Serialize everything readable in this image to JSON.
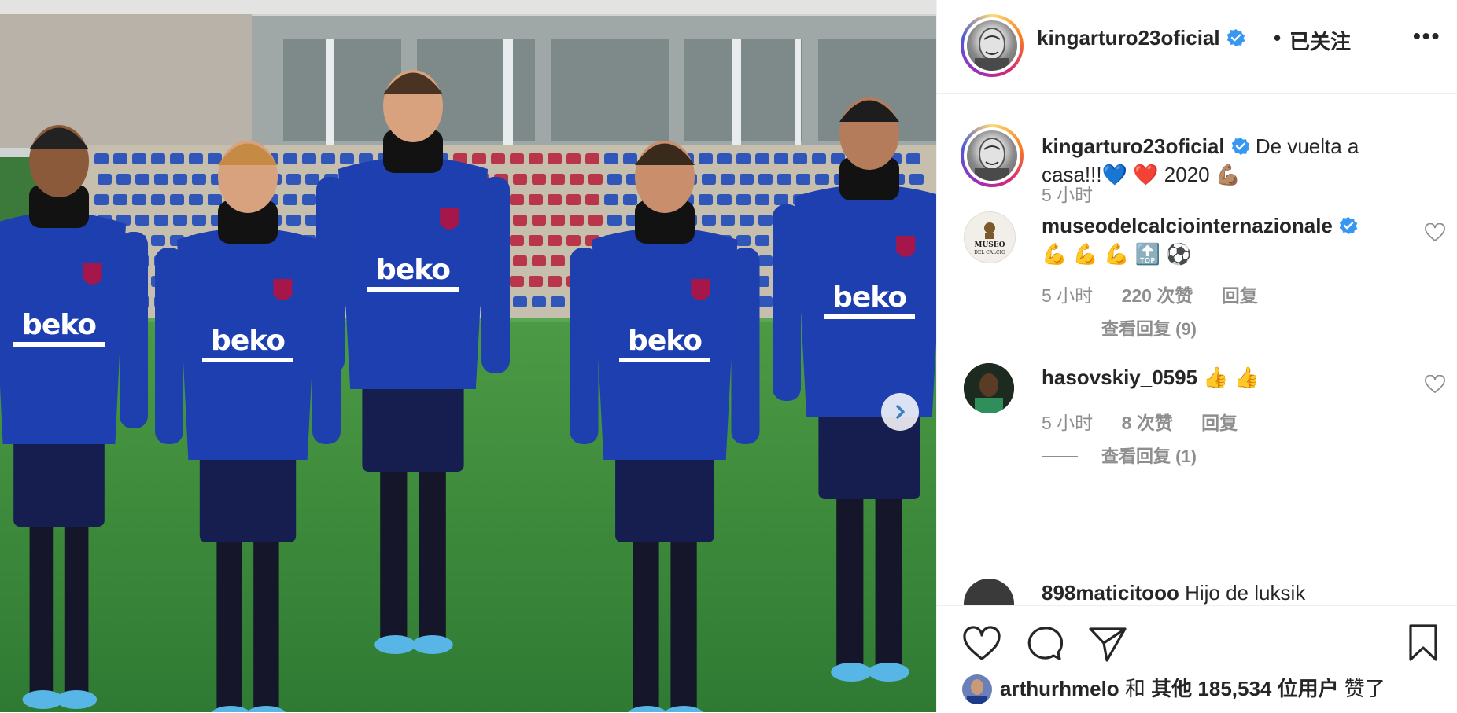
{
  "post": {
    "author": "kingarturo23oficial",
    "follow_status": "已关注",
    "separator": "•",
    "more_label": "•••"
  },
  "photo": {
    "jersey_sponsor": "beko",
    "next_icon": "chevron-right-icon"
  },
  "caption": {
    "username": "kingarturo23oficial",
    "text_line1": "De vuelta a",
    "text_line2": "casa!!!💙 ❤️  2020 💪🏽",
    "time": "5 小时"
  },
  "comments": [
    {
      "username": "museodelcalciointernazionale",
      "text": "💪 💪 💪 🔝 ⚽",
      "time": "5 小时",
      "likes": "220 次赞",
      "reply_label": "回复",
      "view_replies": "查看回复 (9)",
      "avatar_text": "MUSEO DEL CALCIO"
    },
    {
      "username": "hasovskiy_0595",
      "text": "👍 👍",
      "time": "5 小时",
      "likes": "8 次赞",
      "reply_label": "回复",
      "view_replies": "查看回复 (1)"
    },
    {
      "username": "898maticitooo",
      "text": "Hijo de luksik"
    }
  ],
  "likes": {
    "liker": "arthurhmelo",
    "connector": "和",
    "others": "其他 185,534 位用户",
    "suffix": "赞了"
  },
  "colors": {
    "verified": "#3897f0",
    "jersey": "#1d3fb0",
    "grass": "#3e8a3c",
    "text": "#262626",
    "muted": "#8e8e8e"
  }
}
